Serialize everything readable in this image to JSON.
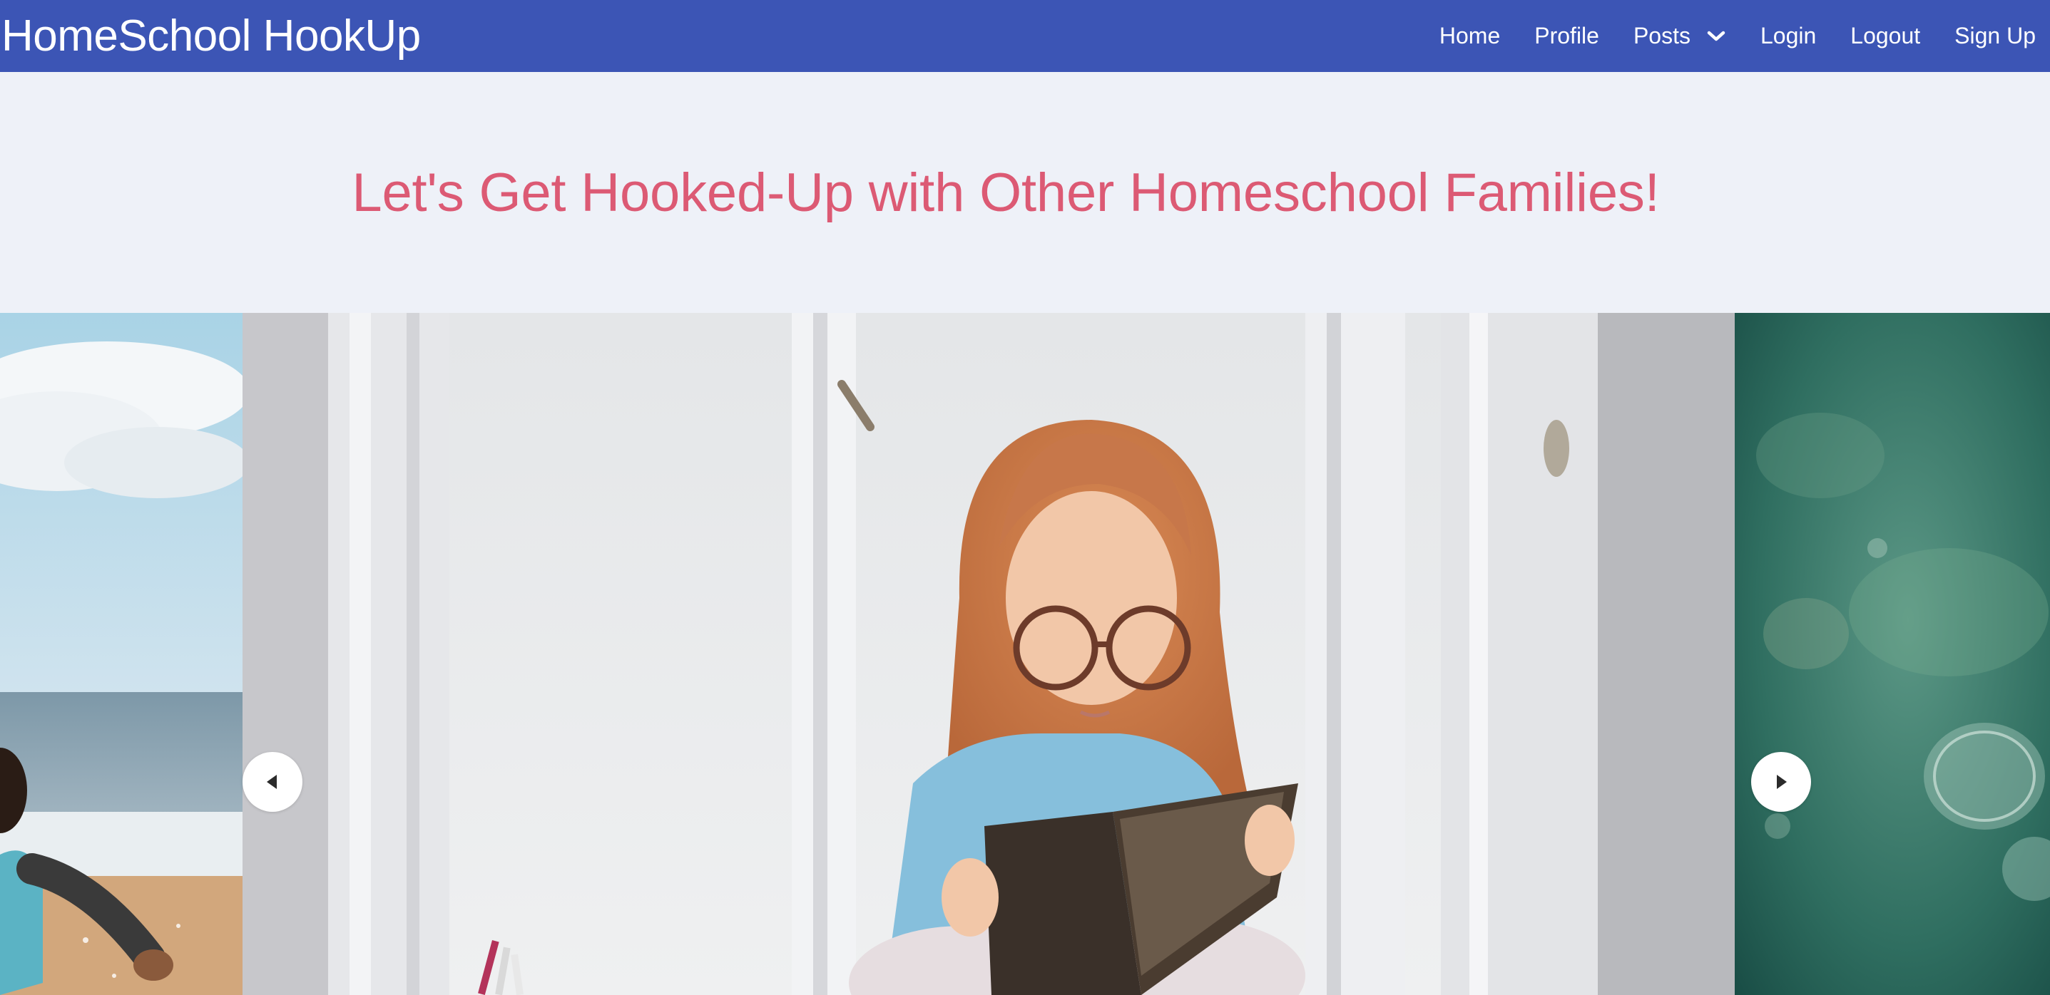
{
  "navbar": {
    "brand": "HomeSchool HookUp",
    "items": [
      {
        "label": "Home"
      },
      {
        "label": "Profile"
      },
      {
        "label": "Posts",
        "icon": "chevron-down-icon"
      },
      {
        "label": "Login"
      },
      {
        "label": "Logout"
      },
      {
        "label": "Sign Up"
      }
    ]
  },
  "hero": {
    "title": "Let's Get Hooked-Up with Other Homeschool Families!"
  },
  "carousel": {
    "prev_icon": "caret-left-icon",
    "next_icon": "caret-right-icon",
    "slides": [
      {
        "name": "beach-child-photo"
      },
      {
        "name": "girl-reading-book-photo"
      },
      {
        "name": "underwater-bubbles-photo"
      }
    ]
  },
  "colors": {
    "navbar_bg": "#3c55b5",
    "hero_bg": "#eef1f8",
    "hero_title": "#dc5a74"
  }
}
